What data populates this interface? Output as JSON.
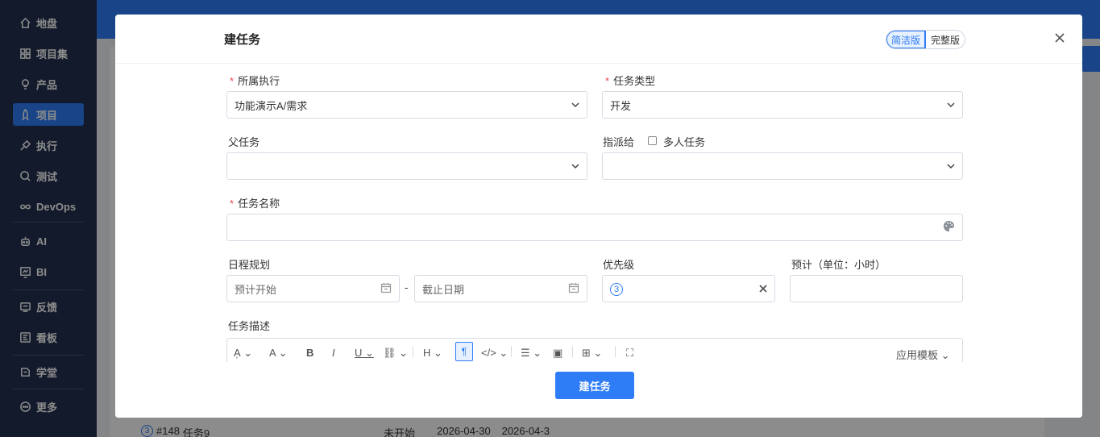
{
  "sidebar": {
    "items": [
      {
        "label": "地盘",
        "icon": "home-icon"
      },
      {
        "label": "项目集",
        "icon": "grid-icon"
      },
      {
        "label": "产品",
        "icon": "bulb-icon"
      },
      {
        "label": "项目",
        "icon": "rocket-icon"
      },
      {
        "label": "执行",
        "icon": "pin-icon"
      },
      {
        "label": "测试",
        "icon": "search-icon"
      },
      {
        "label": "DevOps",
        "icon": "infinity-icon"
      },
      {
        "label": "AI",
        "icon": "robot-icon"
      },
      {
        "label": "BI",
        "icon": "chart-icon"
      },
      {
        "label": "反馈",
        "icon": "feedback-icon"
      },
      {
        "label": "看板",
        "icon": "kanban-icon"
      },
      {
        "label": "学堂",
        "icon": "school-icon"
      },
      {
        "label": "更多",
        "icon": "more-icon"
      }
    ]
  },
  "background": {
    "row": {
      "id": "#148",
      "name": "任务9",
      "status": "未开始",
      "start": "2026-04-30",
      "end": "2026-04-3"
    }
  },
  "modal": {
    "title": "建任务",
    "version_simple": "简洁版",
    "version_full": "完整版",
    "fields": {
      "execution_label": "所属执行",
      "execution_value": "功能演示A/需求",
      "task_type_label": "任务类型",
      "task_type_value": "开发",
      "parent_label": "父任务",
      "assign_label": "指派给",
      "multi_label": "多人任务",
      "name_label": "任务名称",
      "schedule_label": "日程规划",
      "start_placeholder": "预计开始",
      "dash": "-",
      "end_placeholder": "截止日期",
      "priority_label": "优先级",
      "priority_value": "3",
      "estimate_label": "预计（单位：小时）",
      "desc_label": "任务描述",
      "apply_template": "应用模板"
    },
    "submit": "建任务"
  },
  "colors": {
    "primary": "#2e7cf6",
    "sidebar": "#23314f",
    "required": "#e5484d"
  }
}
